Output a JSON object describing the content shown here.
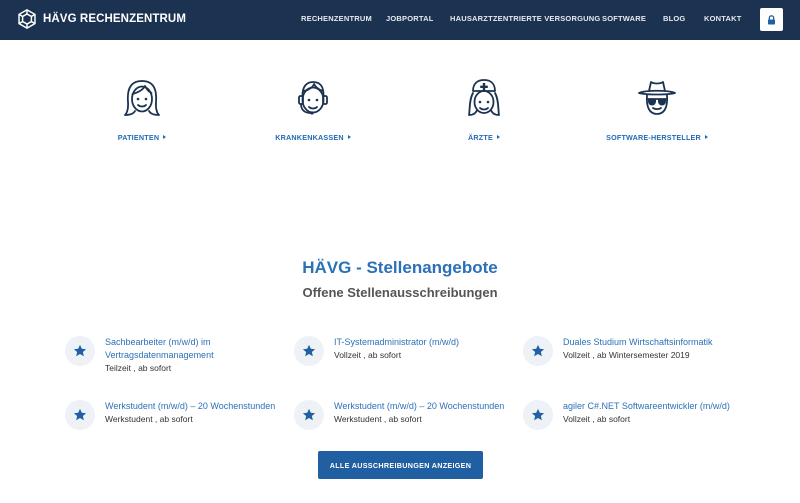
{
  "header": {
    "brand": "HÄVG RECHENZENTRUM",
    "logo_icon": "snowflake-logo-icon",
    "nav": [
      "RECHENZENTRUM",
      "JOBPORTAL",
      "HAUSARZTZENTRIERTE VERSORGUNG",
      "SOFTWARE",
      "BLOG",
      "KONTAKT"
    ],
    "login_icon": "lock-icon"
  },
  "audiences": [
    {
      "label": "PATIENTEN",
      "icon": "woman-face-icon"
    },
    {
      "label": "KRANKENKASSEN",
      "icon": "headset-agent-icon"
    },
    {
      "label": "ÄRZTE",
      "icon": "nurse-icon"
    },
    {
      "label": "SOFTWARE-HERSTELLER",
      "icon": "hat-sunglasses-icon"
    }
  ],
  "jobs": {
    "title": "HÄVG - Stellenangebote",
    "subtitle": "Offene Stellenausschreibungen",
    "items": [
      {
        "title": "Sachbearbeiter (m/w/d) im Vertragsdatenmanagement",
        "meta": "Teilzeit , ab sofort",
        "icon": "star-icon"
      },
      {
        "title": "IT-Systemadministrator (m/w/d)",
        "meta": "Vollzeit , ab sofort",
        "icon": "star-icon"
      },
      {
        "title": "Duales Studium Wirtschaftsinformatik",
        "meta": "Vollzeit , ab Wintersemester 2019",
        "icon": "star-icon"
      },
      {
        "title": "Werkstudent (m/w/d) – 20 Wochenstunden",
        "meta": "Werkstudent , ab sofort",
        "icon": "star-icon"
      },
      {
        "title": "Werkstudent (m/w/d) – 20 Wochenstunden",
        "meta": "Werkstudent , ab sofort",
        "icon": "star-icon"
      },
      {
        "title": "agiler C#.NET Softwareentwickler (m/w/d)",
        "meta": "Vollzeit , ab sofort",
        "icon": "star-icon"
      }
    ],
    "button": "ALLE AUSSCHREIBUNGEN ANZEIGEN"
  },
  "colors": {
    "header_bg": "#1b3350",
    "accent": "#2b71b8",
    "button_bg": "#1f5fa2"
  }
}
